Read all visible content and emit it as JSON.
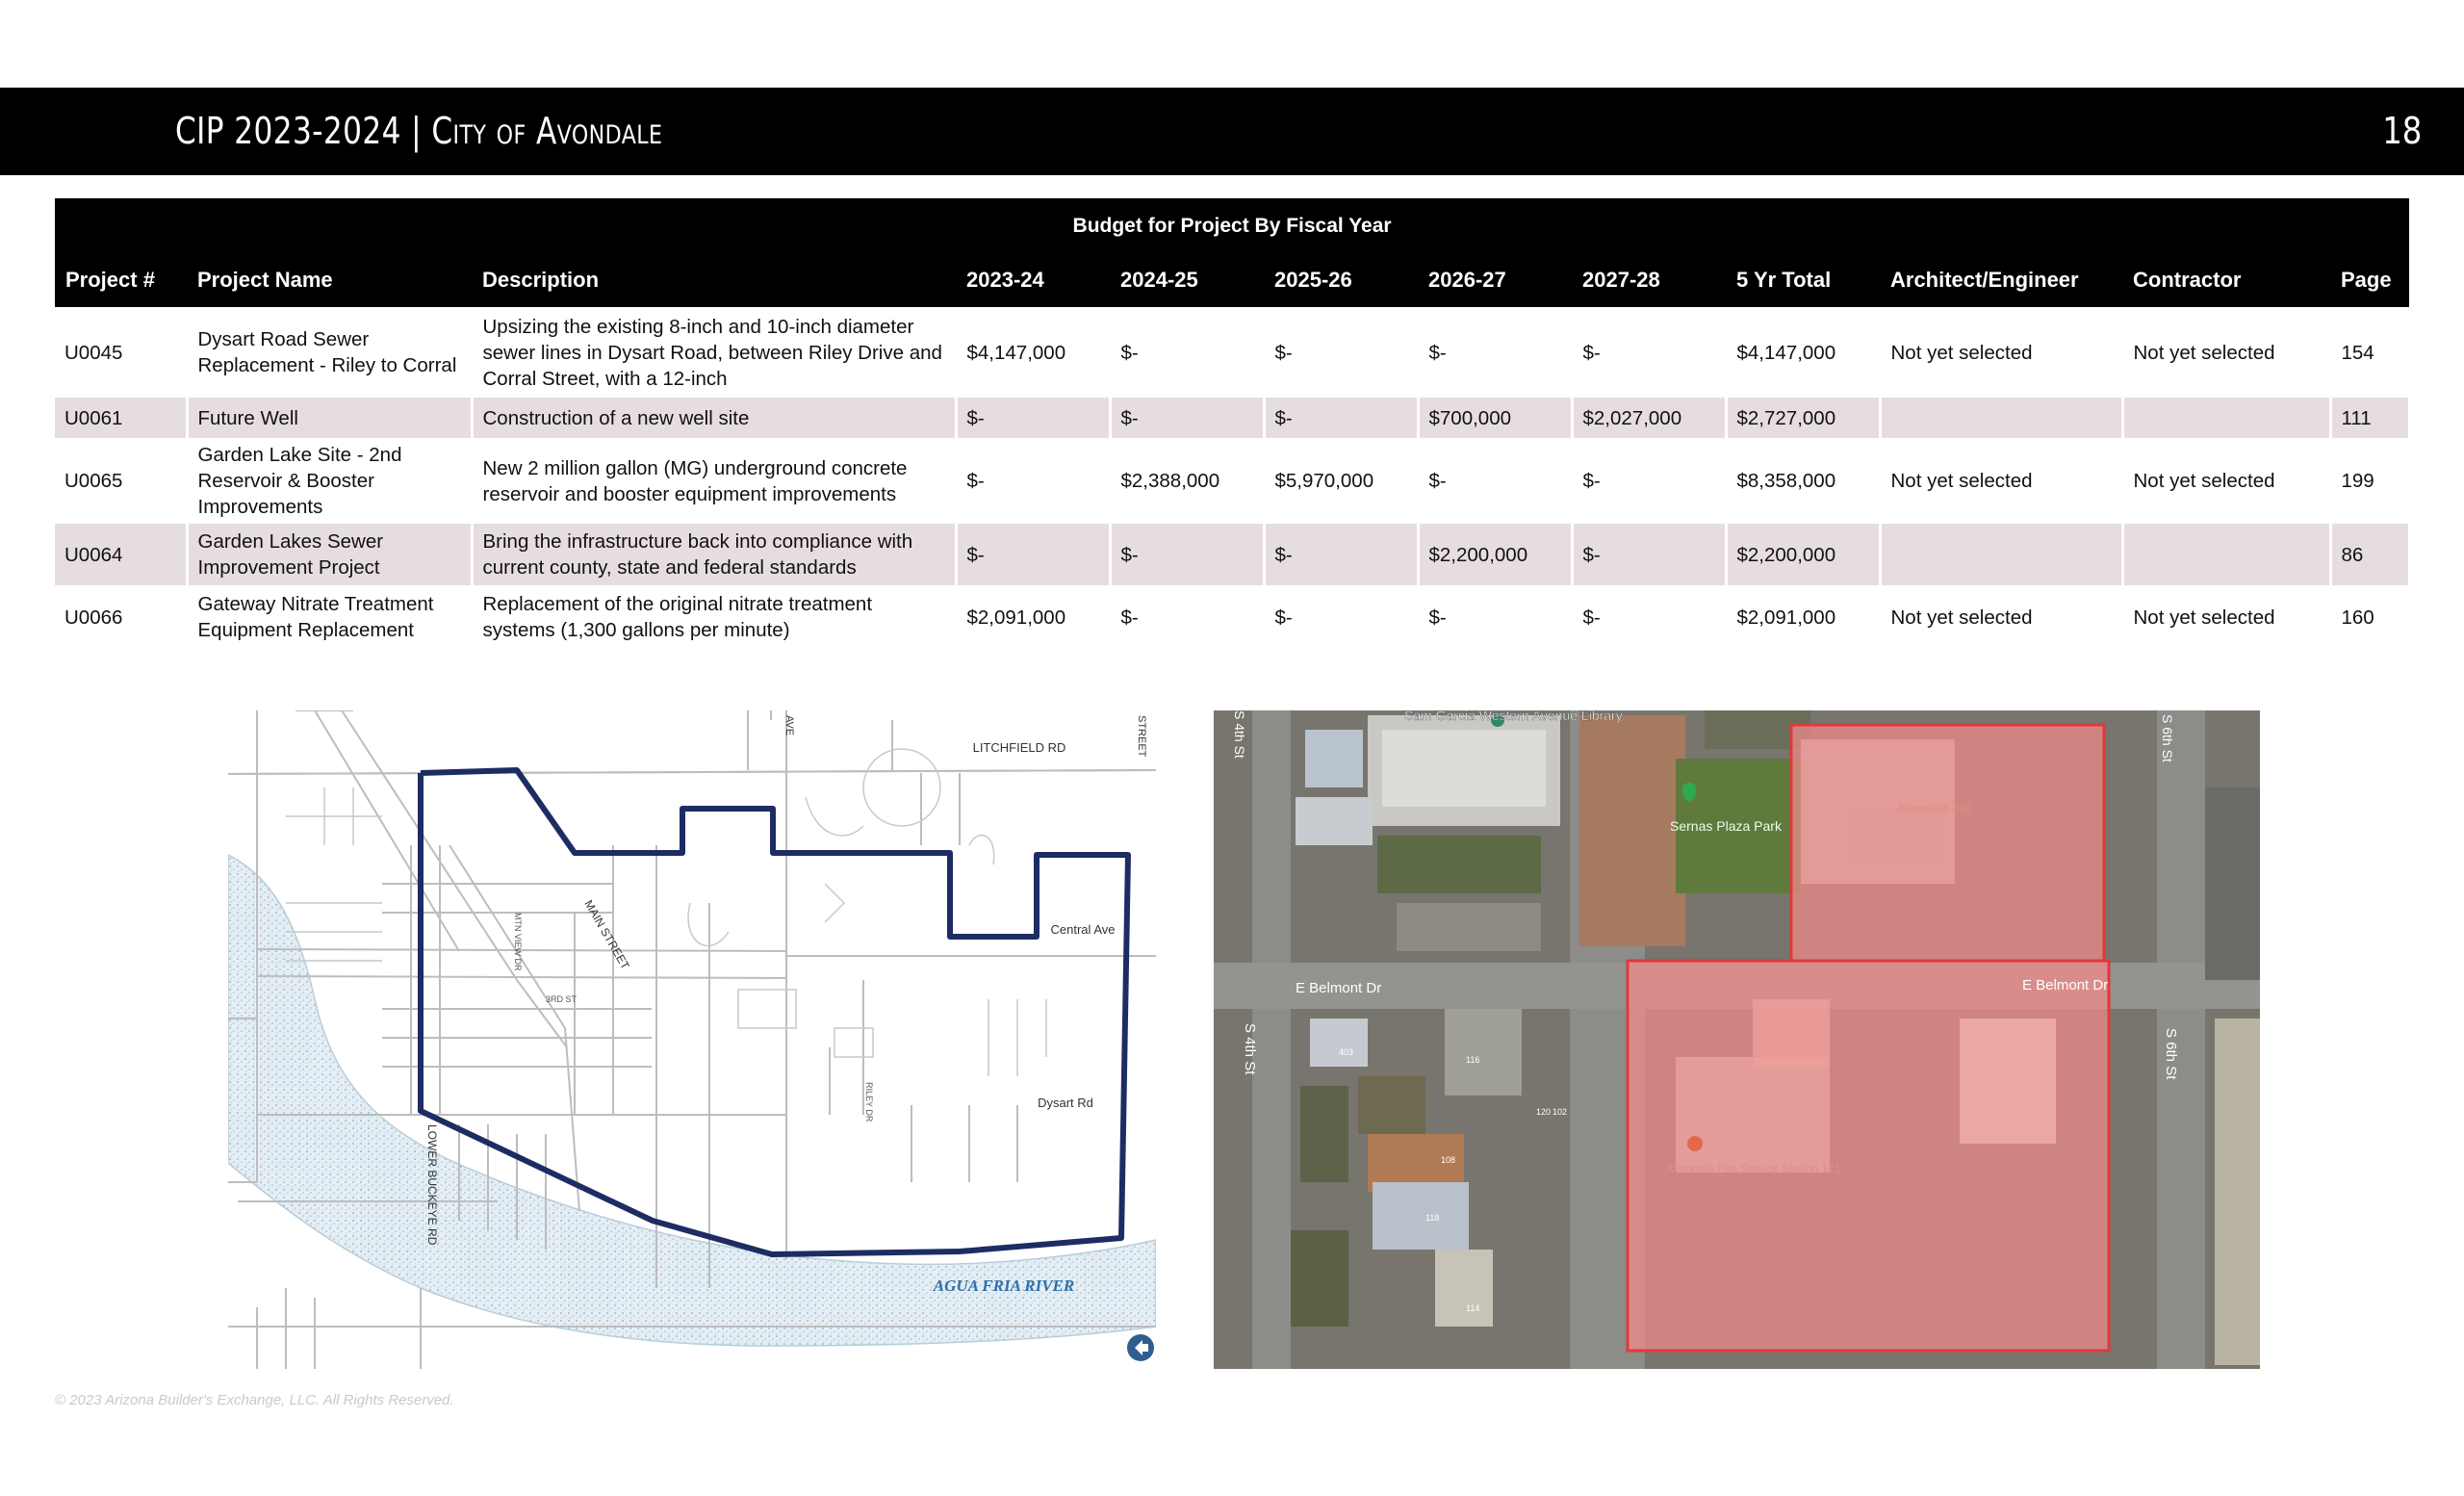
{
  "header": {
    "title": "CIP 2023-2024 | City of Avondale",
    "page_number": "18"
  },
  "table": {
    "super_header": "Budget for Project By Fiscal Year",
    "columns": [
      "Project #",
      "Project Name",
      "Description",
      "2023-24",
      "2024-25",
      "2025-26",
      "2026-27",
      "2027-28",
      "5 Yr Total",
      "Architect/Engineer",
      "Contractor",
      "Page"
    ],
    "rows": [
      {
        "project": "U0045",
        "name": "Dysart Road Sewer Replacement - Riley to Corral",
        "description": "Upsizing the existing 8-inch and 10-inch diameter sewer lines in Dysart Road, between Riley Drive and Corral Street, with a 12-inch",
        "fy2324": "$4,147,000",
        "fy2425": "$-",
        "fy2526": "$-",
        "fy2627": "$-",
        "fy2728": "$-",
        "total": "$4,147,000",
        "architect": "Not yet selected",
        "contractor": "Not yet selected",
        "page": "154"
      },
      {
        "project": "U0061",
        "name": "Future Well",
        "description": "Construction of a new well site",
        "fy2324": "$-",
        "fy2425": "$-",
        "fy2526": "$-",
        "fy2627": "$700,000",
        "fy2728": "$2,027,000",
        "total": "$2,727,000",
        "architect": "",
        "contractor": "",
        "page": "111"
      },
      {
        "project": "U0065",
        "name": "Garden Lake Site - 2nd Reservoir & Booster Improvements",
        "description": "New 2 million gallon (MG) underground concrete reservoir and booster equipment improvements",
        "fy2324": "$-",
        "fy2425": "$2,388,000",
        "fy2526": "$5,970,000",
        "fy2627": "$-",
        "fy2728": "$-",
        "total": "$8,358,000",
        "architect": "Not yet selected",
        "contractor": "Not yet selected",
        "page": "199"
      },
      {
        "project": "U0064",
        "name": "Garden Lakes Sewer Improvement Project",
        "description": "Bring the infrastructure back into compliance with current county, state and federal standards",
        "fy2324": "$-",
        "fy2425": "$-",
        "fy2526": "$-",
        "fy2627": "$2,200,000",
        "fy2728": "$-",
        "total": "$2,200,000",
        "architect": "",
        "contractor": "",
        "page": "86"
      },
      {
        "project": "U0066",
        "name": "Gateway Nitrate Treatment Equipment Replacement",
        "description": "Replacement of the original nitrate treatment systems (1,300 gallons per minute)",
        "fy2324": "$2,091,000",
        "fy2425": "$-",
        "fy2526": "$-",
        "fy2627": "$-",
        "fy2728": "$-",
        "total": "$2,091,000",
        "architect": "Not yet selected",
        "contractor": "Not yet selected",
        "page": "160"
      }
    ]
  },
  "map_left": {
    "labels": {
      "litchfield": "LITCHFIELD  RD",
      "central": "Central  Ave",
      "dysart": "Dysart  Rd",
      "main_street": "MAIN STREET",
      "mtn_view": "MTN VIEW DR",
      "third_st": "3RD ST",
      "riley": "RILEY DR",
      "lower_buckeye": "LOWER BUCKEYE RD",
      "river": "AGUA FRIA RIVER",
      "ave_top": "AVE",
      "street_top": "STREET"
    },
    "boundary_color": "#1d2c63",
    "river_color": "#dde9f1"
  },
  "map_right": {
    "labels": {
      "library": "Sam Garcia Western Avenue Library",
      "park": "Sernas Plaza Park",
      "belmont_w": "E Belmont Dr",
      "belmont_e": "E Belmont Dr",
      "fourth_st": "S 4th St",
      "fourth_st_top": "S 4th St",
      "sixth_st": "S 6th St",
      "sixth_st_top": "S 6th St",
      "jail": "Avondale Jail",
      "fire": "Avondale Fire Service Station 171",
      "house_1": "403",
      "house_2": "116",
      "house_3": "120",
      "house_4": "108",
      "house_5": "118",
      "house_6": "114",
      "house_7": "102"
    },
    "highlight_color": "#f08a8a"
  },
  "footer": {
    "copyright": "© 2023  Arizona Builder's Exchange, LLC. All Rights Reserved."
  }
}
